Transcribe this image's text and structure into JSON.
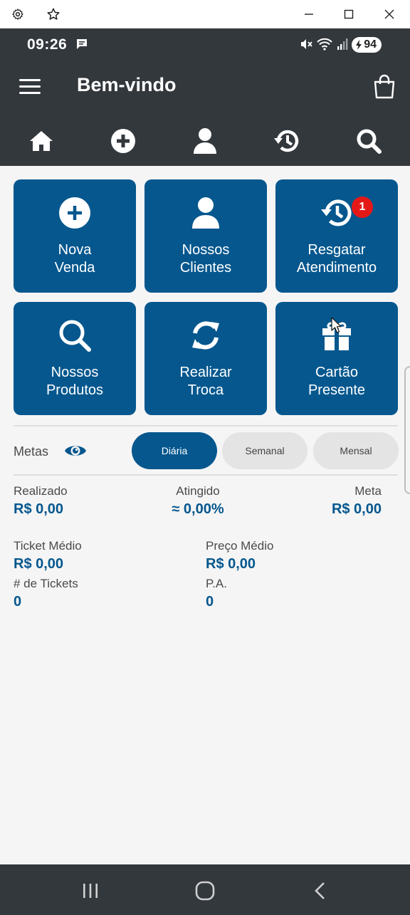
{
  "window": {
    "icons": [
      "gear-icon",
      "star-icon",
      "minimize-icon",
      "maximize-icon",
      "close-icon"
    ]
  },
  "status_bar": {
    "time": "09:26",
    "battery": "94"
  },
  "header": {
    "title": "Bem-vindo"
  },
  "nav": [
    "home-icon",
    "add-circle-icon",
    "person-icon",
    "history-icon",
    "search-icon"
  ],
  "tiles": [
    {
      "line1": "Nova",
      "line2": "Venda",
      "icon": "add-circle-icon"
    },
    {
      "line1": "Nossos",
      "line2": "Clientes",
      "icon": "person-icon"
    },
    {
      "line1": "Resgatar",
      "line2": "Atendimento",
      "icon": "history-icon",
      "badge": "1"
    },
    {
      "line1": "Nossos",
      "line2": "Produtos",
      "icon": "search-icon"
    },
    {
      "line1": "Realizar",
      "line2": "Troca",
      "icon": "refresh-icon"
    },
    {
      "line1": "Cartão",
      "line2": "Presente",
      "icon": "gift-icon"
    }
  ],
  "metas": {
    "label": "Metas",
    "periods": [
      "Diária",
      "Semanal",
      "Mensal"
    ],
    "selected": "Diária"
  },
  "summary": {
    "realizado_label": "Realizado",
    "realizado_value": "R$ 0,00",
    "atingido_label": "Atingido",
    "atingido_value": "≈ 0,00%",
    "meta_label": "Meta",
    "meta_value": "R$ 0,00"
  },
  "details": {
    "ticket_medio_label": "Ticket Médio",
    "ticket_medio_value": "R$ 0,00",
    "preco_medio_label": "Preço Médio",
    "preco_medio_value": "R$ 0,00",
    "tickets_label": "# de Tickets",
    "tickets_value": "0",
    "pa_label": "P.A.",
    "pa_value": "0"
  },
  "colors": {
    "primary": "#05578e",
    "header_bg": "#33383d",
    "badge": "#e51818",
    "page_bg": "#f5f5f5"
  }
}
